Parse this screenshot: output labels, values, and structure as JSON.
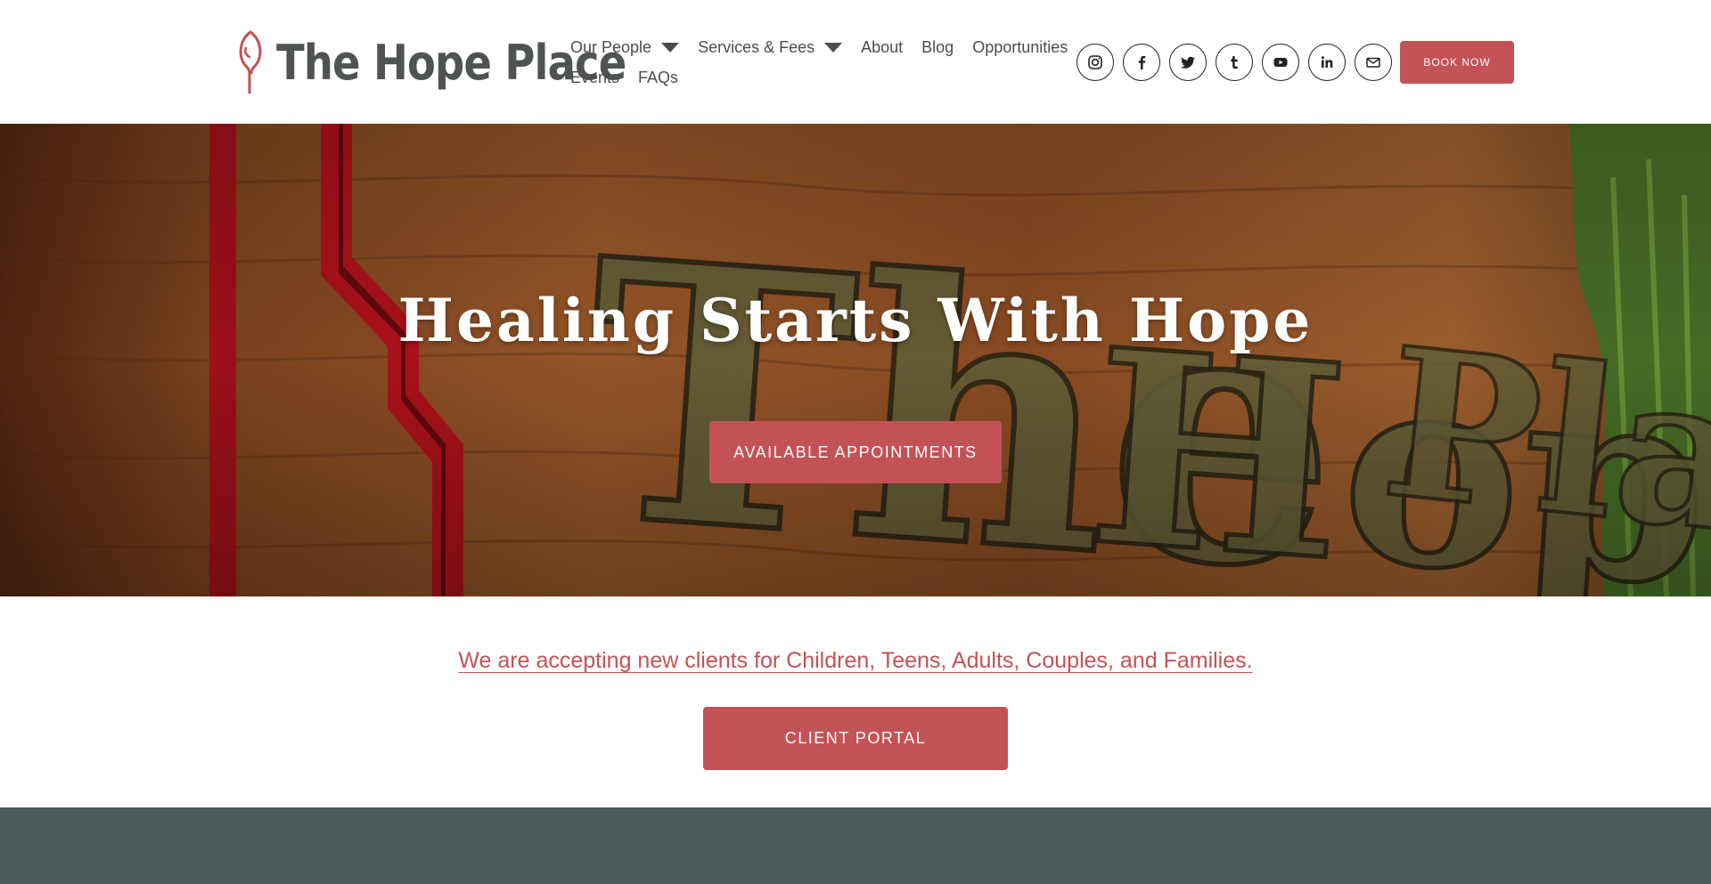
{
  "brand": {
    "name": "The Hope Place",
    "accent_color": "#c35257",
    "text_color": "#4f5352",
    "band_color": "#4b5a5a"
  },
  "nav": {
    "items": [
      {
        "label": "Our People",
        "has_dropdown": true
      },
      {
        "label": "Services & Fees",
        "has_dropdown": true
      },
      {
        "label": "About",
        "has_dropdown": false
      },
      {
        "label": "Blog",
        "has_dropdown": false
      },
      {
        "label": "Opportunities",
        "has_dropdown": false
      },
      {
        "label": "Events",
        "has_dropdown": false
      },
      {
        "label": "FAQs",
        "has_dropdown": false
      }
    ]
  },
  "social": [
    "instagram-icon",
    "facebook-icon",
    "twitter-icon",
    "tumblr-icon",
    "youtube-icon",
    "linkedin-icon",
    "email-icon"
  ],
  "header": {
    "book_label": "BOOK NOW"
  },
  "hero": {
    "title": "Healing Starts With Hope",
    "button_label": "AVAILABLE APPOINTMENTS",
    "sign_text": "The Hope Place"
  },
  "content": {
    "accepting_text": "We are accepting new clients for Children, Teens, Adults, Couples, and Families.",
    "portal_label": "CLIENT PORTAL"
  }
}
